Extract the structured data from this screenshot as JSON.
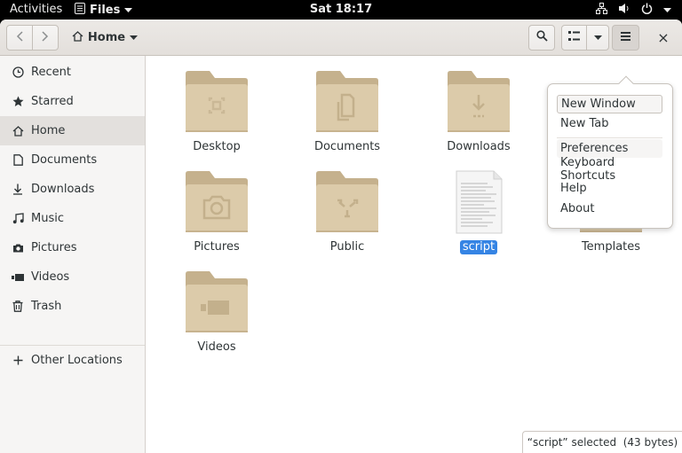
{
  "topbar": {
    "activities": "Activities",
    "app_name": "Files",
    "clock": "Sat 18:17"
  },
  "header": {
    "location": "Home",
    "close": "×"
  },
  "sidebar": {
    "items": [
      {
        "label": "Recent",
        "icon": "clock-icon"
      },
      {
        "label": "Starred",
        "icon": "star-icon"
      },
      {
        "label": "Home",
        "icon": "home-icon",
        "active": true
      },
      {
        "label": "Documents",
        "icon": "document-icon"
      },
      {
        "label": "Downloads",
        "icon": "download-icon"
      },
      {
        "label": "Music",
        "icon": "music-icon"
      },
      {
        "label": "Pictures",
        "icon": "camera-icon"
      },
      {
        "label": "Videos",
        "icon": "video-icon"
      },
      {
        "label": "Trash",
        "icon": "trash-icon"
      }
    ],
    "other_locations": "Other Locations"
  },
  "files": [
    {
      "name": "Desktop",
      "type": "folder",
      "emblem": "desktop"
    },
    {
      "name": "Documents",
      "type": "folder",
      "emblem": "documents"
    },
    {
      "name": "Downloads",
      "type": "folder",
      "emblem": "downloads"
    },
    {
      "name": "Pictures",
      "type": "folder",
      "emblem": "pictures"
    },
    {
      "name": "Public",
      "type": "folder",
      "emblem": "public"
    },
    {
      "name": "script",
      "type": "text-file",
      "selected": true
    },
    {
      "name": "Templates",
      "type": "folder",
      "emblem": "templates"
    },
    {
      "name": "Videos",
      "type": "folder",
      "emblem": "videos"
    }
  ],
  "menu": {
    "new_window": "New Window",
    "new_tab": "New Tab",
    "preferences": "Preferences",
    "keyboard_shortcuts": "Keyboard Shortcuts",
    "help": "Help",
    "about": "About"
  },
  "status": "“script” selected  (43 bytes)",
  "colors": {
    "folder": "#d9c8a6",
    "folder_tab": "#c5b18d",
    "selection": "#3584e4",
    "sidebar_bg": "#f6f5f4"
  }
}
